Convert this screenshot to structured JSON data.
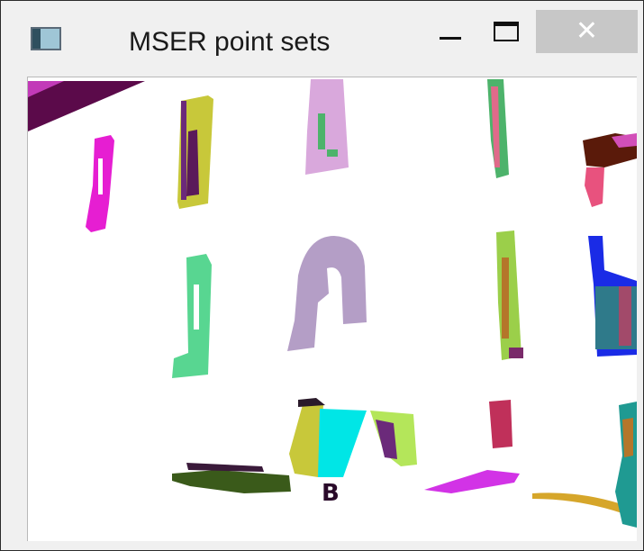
{
  "window": {
    "title": "MSER point sets",
    "buttons": {
      "minimize_icon": "minimize-icon",
      "maximize_icon": "maximize-icon",
      "close_glyph": "✕"
    }
  },
  "colors": {
    "titlebar_bg": "#f0f0f0",
    "close_hover_bg": "#c7c7c7",
    "canvas_bg": "#ffffff",
    "region_colors": [
      "#5b0a4a",
      "#e61ed2",
      "#c8c83a",
      "#d9a8dc",
      "#4db36b",
      "#5a1a0a",
      "#e8527e",
      "#58d691",
      "#b49ec6",
      "#9bcf4a",
      "#1a2be6",
      "#2f7a8a",
      "#00e6e6",
      "#b4e65a",
      "#c0305a",
      "#6b2a7a",
      "#3a5a1a",
      "#d233e6",
      "#d6a62a",
      "#1f9a92"
    ]
  },
  "canvas": {
    "content": "MSER region point sets visualization"
  }
}
